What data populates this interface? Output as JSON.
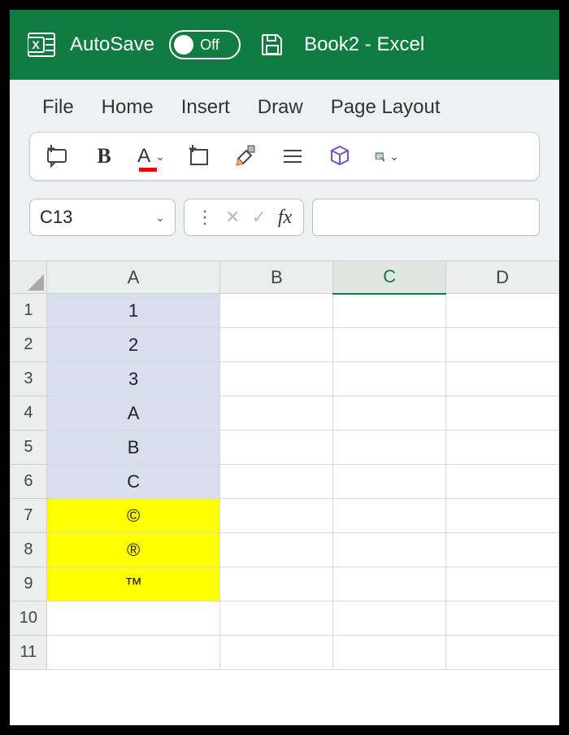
{
  "titlebar": {
    "autosave_label": "AutoSave",
    "autosave_state": "Off",
    "doc_title": "Book2  -  Excel"
  },
  "tabs": [
    "File",
    "Home",
    "Insert",
    "Draw",
    "Page Layout"
  ],
  "toolbar": {
    "bold": "B",
    "fontcolor_letter": "A"
  },
  "namebox": {
    "value": "C13"
  },
  "fx_label": "fx",
  "formula_value": "",
  "columns": [
    "A",
    "B",
    "C",
    "D"
  ],
  "active_column": "C",
  "rows": [
    1,
    2,
    3,
    4,
    5,
    6,
    7,
    8,
    9,
    10,
    11
  ],
  "cells": {
    "A1": "1",
    "A2": "2",
    "A3": "3",
    "A4": "A",
    "A5": "B",
    "A6": "C",
    "A7": "©",
    "A8": "®",
    "A9": "™"
  },
  "fills": {
    "A1": "blue",
    "A2": "blue",
    "A3": "blue",
    "A4": "blue",
    "A5": "blue",
    "A6": "blue",
    "A7": "yellow",
    "A8": "yellow",
    "A9": "yellow"
  }
}
